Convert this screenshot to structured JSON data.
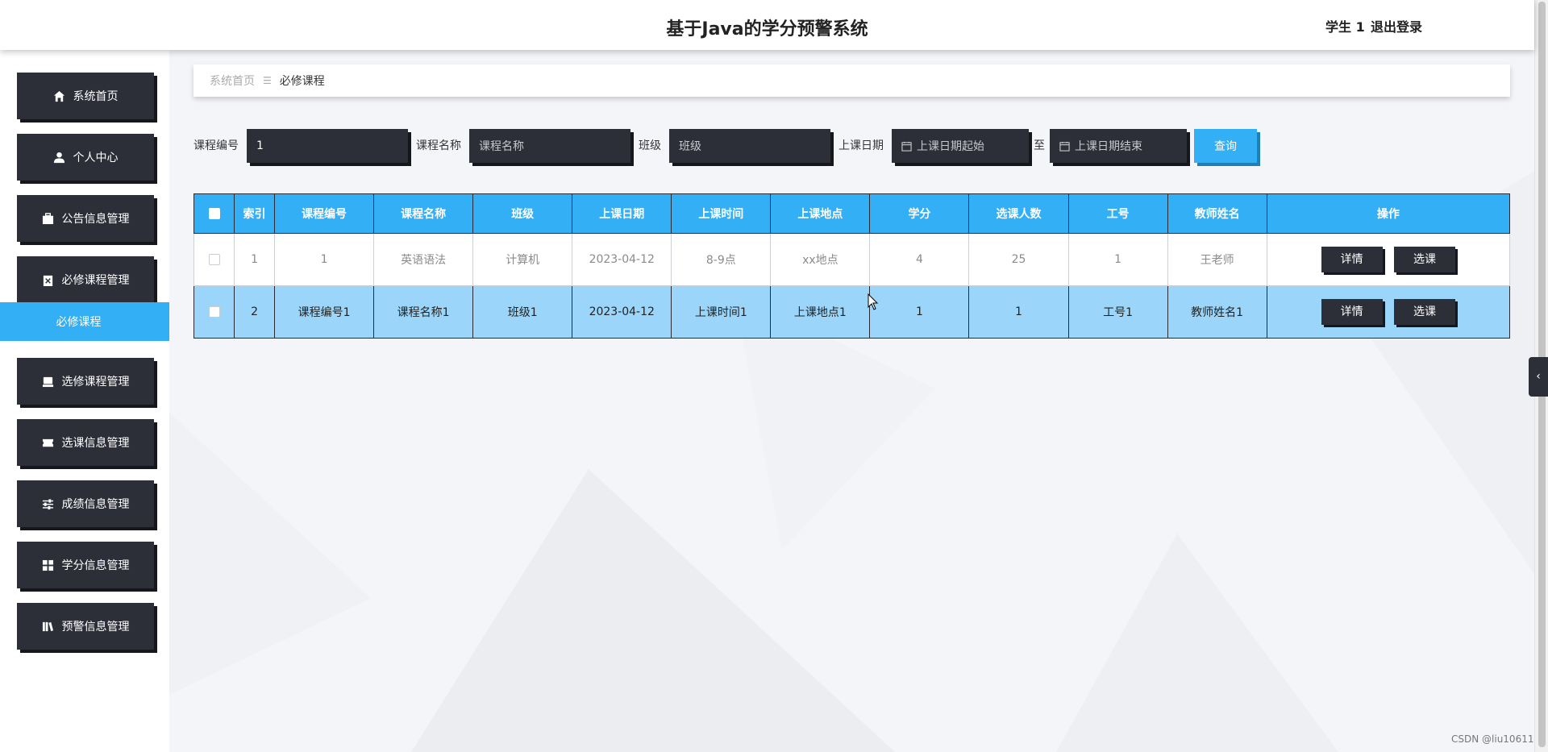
{
  "header": {
    "title": "基于Java的学分预警系统",
    "user": "学生 1",
    "logout": "退出登录"
  },
  "sidebar": {
    "items": [
      {
        "label": "系统首页",
        "icon": "home-icon"
      },
      {
        "label": "个人中心",
        "icon": "user-icon"
      },
      {
        "label": "公告信息管理",
        "icon": "briefcase-icon"
      },
      {
        "label": "必修课程管理",
        "icon": "clipboard-icon"
      },
      {
        "label": "选修课程管理",
        "icon": "tray-icon"
      },
      {
        "label": "选课信息管理",
        "icon": "ticket-icon"
      },
      {
        "label": "成绩信息管理",
        "icon": "sliders-icon"
      },
      {
        "label": "学分信息管理",
        "icon": "grid-icon"
      },
      {
        "label": "预警信息管理",
        "icon": "book-icon"
      }
    ],
    "active_submenu": "必修课程"
  },
  "breadcrumb": {
    "home": "系统首页",
    "current": "必修课程"
  },
  "search": {
    "course_no_label": "课程编号",
    "course_no_value": "1",
    "course_name_label": "课程名称",
    "course_name_placeholder": "课程名称",
    "class_label": "班级",
    "class_placeholder": "班级",
    "date_label": "上课日期",
    "date_start_placeholder": "上课日期起始",
    "to_label": "至",
    "date_end_placeholder": "上课日期结束",
    "query_button": "查询"
  },
  "table": {
    "headers": [
      "索引",
      "课程编号",
      "课程名称",
      "班级",
      "上课日期",
      "上课时间",
      "上课地点",
      "学分",
      "选课人数",
      "工号",
      "教师姓名",
      "操作"
    ],
    "rows": [
      [
        "1",
        "1",
        "英语语法",
        "计算机",
        "2023-04-12",
        "8-9点",
        "xx地点",
        "4",
        "25",
        "1",
        "王老师"
      ],
      [
        "2",
        "课程编号1",
        "课程名称1",
        "班级1",
        "2023-04-12",
        "上课时间1",
        "上课地点1",
        "1",
        "1",
        "工号1",
        "教师姓名1"
      ]
    ],
    "detail_button": "详情",
    "select_button": "选课"
  },
  "watermark": "CSDN @liu10611",
  "colors": {
    "accent": "#33aff5",
    "dark": "#2c2e38",
    "selected_row": "#9bd6fa"
  }
}
